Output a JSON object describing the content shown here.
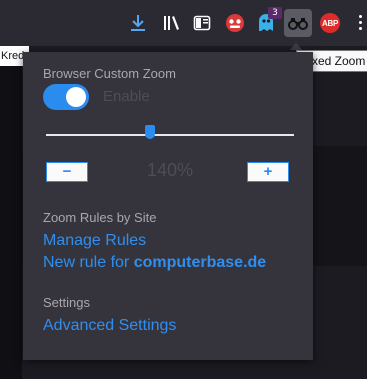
{
  "toolbar": {
    "downloads_icon": "download-arrow-icon",
    "library_icon": "library-icon",
    "sidebar_icon": "sidebar-icon",
    "extension1_icon": "red-face-extension-icon",
    "extension2_icon": "ghost-extension-icon",
    "extension2_badge": "3",
    "fixed_zoom_icon": "binoculars-icon",
    "abp_label": "ABP",
    "menu_icon": "vertical-dots-menu-icon"
  },
  "page": {
    "left_text": "Kred"
  },
  "tooltip": {
    "text": "Fixed Zoom"
  },
  "popup": {
    "title": "Browser Custom Zoom",
    "toggle_label": "Enable",
    "toggle_on": true,
    "zoom_value": "140%",
    "slider_fraction": 0.42,
    "minus_label": "−",
    "plus_label": "+",
    "rules_title": "Zoom Rules by Site",
    "manage_rules": "Manage Rules",
    "new_rule_prefix": "New rule for ",
    "new_rule_site": "computerbase.de",
    "settings_title": "Settings",
    "advanced_settings": "Advanced Settings"
  },
  "colors": {
    "accent": "#2b8cf0",
    "panel_bg": "#35343d",
    "toolbar_bg": "#2b2a33",
    "link": "#2f8ff0"
  }
}
